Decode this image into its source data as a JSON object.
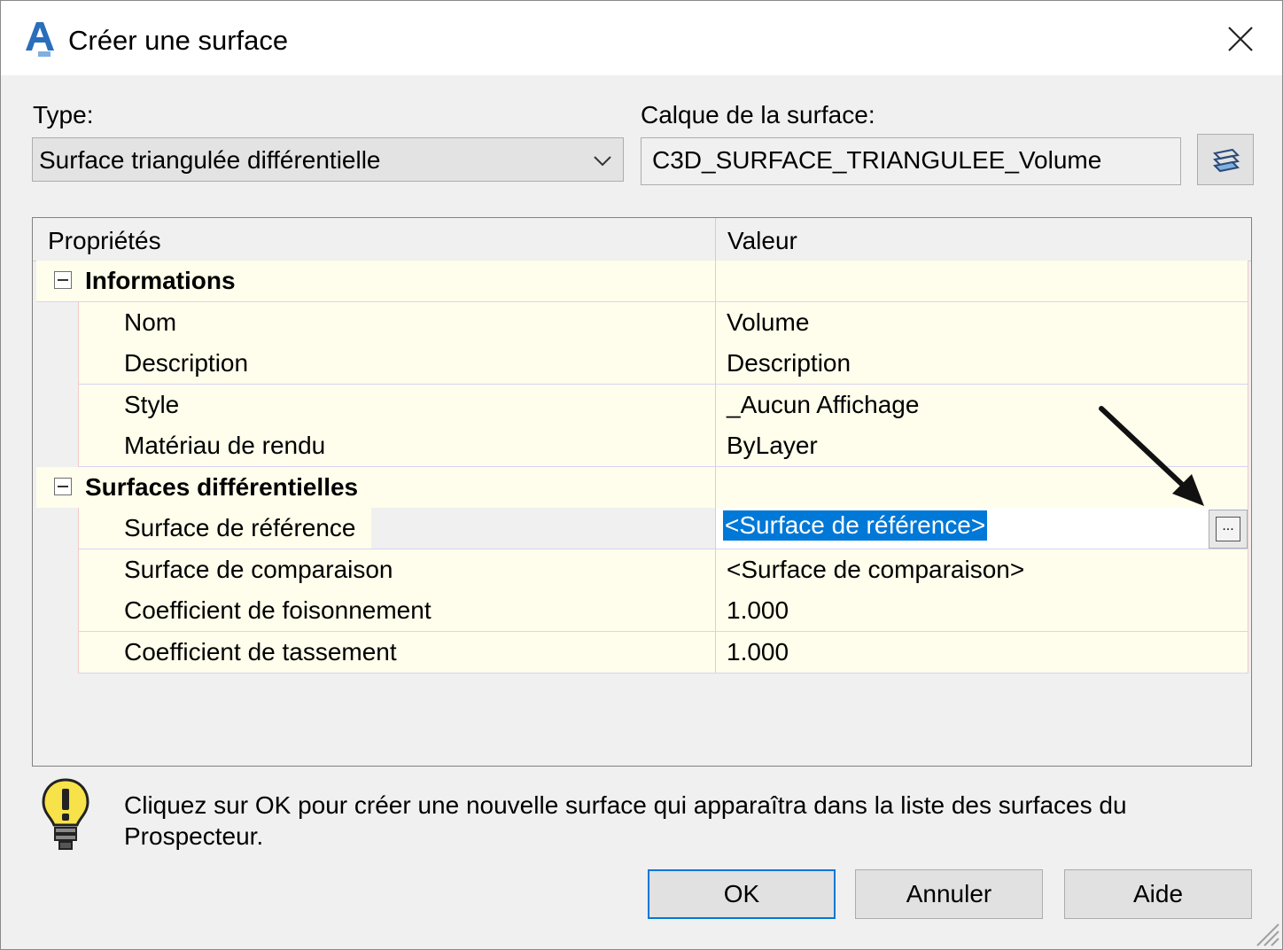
{
  "window": {
    "title": "Créer une surface",
    "app_icon": "autocad-civil3d-icon",
    "close_glyph": "close-icon"
  },
  "type": {
    "label": "Type:",
    "selected": "Surface triangulée différentielle"
  },
  "layer": {
    "label": "Calque de la surface:",
    "value": "C3D_SURFACE_TRIANGULEE_Volume",
    "button_icon": "layers-icon"
  },
  "grid": {
    "col_property": "Propriétés",
    "col_value": "Valeur",
    "categories": [
      {
        "name": "Informations",
        "rows": [
          {
            "property": "Nom",
            "value": "Volume"
          },
          {
            "property": "Description",
            "value": "Description"
          },
          {
            "property": "Style",
            "value": "_Aucun Affichage"
          },
          {
            "property": "Matériau de rendu",
            "value": "ByLayer"
          }
        ]
      },
      {
        "name": "Surfaces différentielles",
        "rows": [
          {
            "property": "Surface de référence",
            "value": "<Surface de référence>",
            "selected": true
          },
          {
            "property": "Surface de comparaison",
            "value": "<Surface de comparaison>"
          },
          {
            "property": "Coefficient de foisonnement",
            "value": "1.000"
          },
          {
            "property": "Coefficient de tassement",
            "value": "1.000"
          }
        ]
      }
    ],
    "ellipsis_label": "..."
  },
  "info": {
    "icon": "lightbulb-icon",
    "text": "Cliquez sur OK pour créer une nouvelle surface qui apparaîtra dans la liste des surfaces du Prospecteur."
  },
  "buttons": {
    "ok": "OK",
    "cancel": "Annuler",
    "help": "Aide"
  },
  "colors": {
    "selection": "#0078d7",
    "grid_row": "#fffdeb",
    "default_button_border": "#0078d7"
  }
}
